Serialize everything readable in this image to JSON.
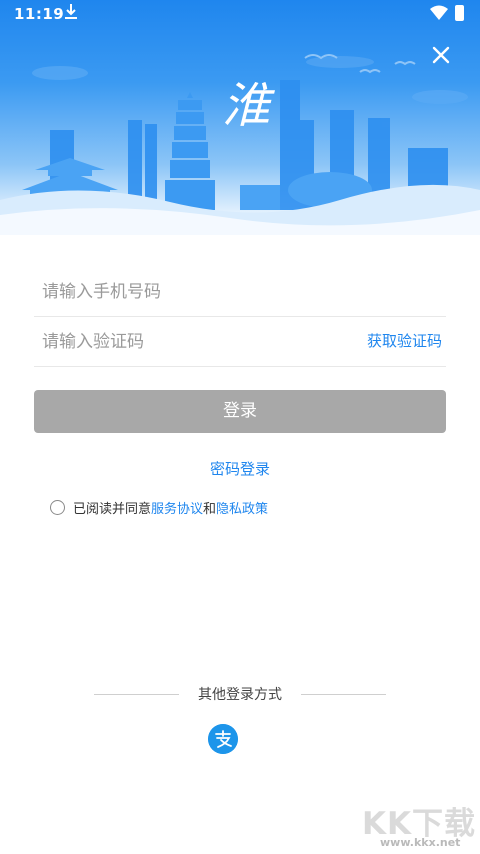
{
  "status_bar": {
    "time": "11:19"
  },
  "header": {
    "calligraphy": "淮"
  },
  "form": {
    "phone_placeholder": "请输入手机号码",
    "code_placeholder": "请输入验证码",
    "get_code_label": "获取验证码",
    "login_label": "登录",
    "password_login_label": "密码登录"
  },
  "agreement": {
    "prefix": "已阅读并同意",
    "service_link": "服务协议",
    "joiner": "和",
    "privacy_link": "隐私政策"
  },
  "other_login": {
    "title": "其他登录方式",
    "alipay_icon": "alipay-icon"
  },
  "watermark": {
    "main": "KK下载",
    "sub": "www.kkx.net"
  },
  "colors": {
    "accent": "#1f86ee",
    "login_disabled": "#a8a8a8"
  }
}
